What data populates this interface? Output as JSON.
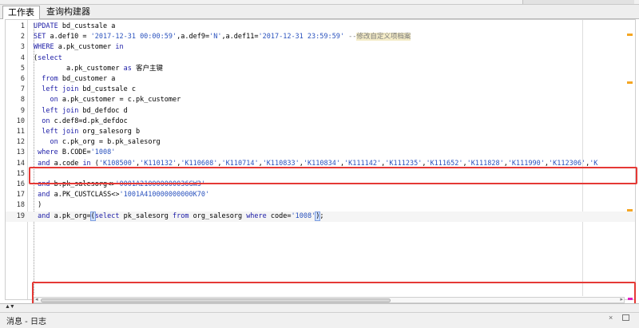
{
  "tabs": [
    {
      "label": "工作表"
    },
    {
      "label": "查询构建器"
    }
  ],
  "editor": {
    "lines": [
      {
        "n": "1",
        "parts": [
          {
            "t": "UPDATE",
            "c": "kw"
          },
          {
            "t": " bd_custsale a",
            "c": ""
          }
        ]
      },
      {
        "n": "2",
        "parts": [
          {
            "t": "SET",
            "c": "kw"
          },
          {
            "t": " a.def10 = ",
            "c": ""
          },
          {
            "t": "'2017-12-31 00:00:59'",
            "c": "str"
          },
          {
            "t": ",a.def9=",
            "c": ""
          },
          {
            "t": "'N'",
            "c": "str"
          },
          {
            "t": ",a.def11=",
            "c": ""
          },
          {
            "t": "'2017-12-31 23:59:59'",
            "c": "str"
          },
          {
            "t": " --",
            "c": "cmt"
          },
          {
            "t": "修改自定义项档案",
            "c": "cmt-hl cjk"
          }
        ]
      },
      {
        "n": "3",
        "parts": [
          {
            "t": "WHERE",
            "c": "kw"
          },
          {
            "t": " a.pk_customer ",
            "c": ""
          },
          {
            "t": "in",
            "c": "kw"
          }
        ]
      },
      {
        "n": "4",
        "parts": [
          {
            "t": "(",
            "c": ""
          },
          {
            "t": "select",
            "c": "kw"
          }
        ]
      },
      {
        "n": "5",
        "parts": [
          {
            "t": "        a.pk_customer ",
            "c": ""
          },
          {
            "t": "as",
            "c": "kw"
          },
          {
            "t": " ",
            "c": ""
          },
          {
            "t": "客户主键",
            "c": "cjk"
          }
        ]
      },
      {
        "n": "6",
        "parts": [
          {
            "t": "  ",
            "c": ""
          },
          {
            "t": "from",
            "c": "kw"
          },
          {
            "t": " bd_customer a",
            "c": ""
          }
        ]
      },
      {
        "n": "7",
        "parts": [
          {
            "t": "  ",
            "c": ""
          },
          {
            "t": "left join",
            "c": "kw"
          },
          {
            "t": " bd_custsale c",
            "c": ""
          }
        ]
      },
      {
        "n": "8",
        "parts": [
          {
            "t": "    ",
            "c": ""
          },
          {
            "t": "on",
            "c": "kw"
          },
          {
            "t": " a.pk_customer = c.pk_customer",
            "c": ""
          }
        ]
      },
      {
        "n": "9",
        "parts": [
          {
            "t": "  ",
            "c": ""
          },
          {
            "t": "left join",
            "c": "kw"
          },
          {
            "t": " bd_defdoc d",
            "c": ""
          }
        ]
      },
      {
        "n": "10",
        "parts": [
          {
            "t": "  ",
            "c": ""
          },
          {
            "t": "on",
            "c": "kw"
          },
          {
            "t": " c.def8=d.pk_defdoc",
            "c": ""
          }
        ]
      },
      {
        "n": "11",
        "parts": [
          {
            "t": "  ",
            "c": ""
          },
          {
            "t": "left join",
            "c": "kw"
          },
          {
            "t": " org_salesorg b",
            "c": ""
          }
        ]
      },
      {
        "n": "12",
        "parts": [
          {
            "t": "    ",
            "c": ""
          },
          {
            "t": "on",
            "c": "kw"
          },
          {
            "t": " c.pk_org = b.pk_salesorg",
            "c": ""
          }
        ]
      },
      {
        "n": "13",
        "parts": [
          {
            "t": " ",
            "c": ""
          },
          {
            "t": "where",
            "c": "kw"
          },
          {
            "t": " B.CODE=",
            "c": ""
          },
          {
            "t": "'1008'",
            "c": "str"
          }
        ]
      },
      {
        "n": "14",
        "parts": [
          {
            "t": " ",
            "c": ""
          },
          {
            "t": "and",
            "c": "kw"
          },
          {
            "t": " a.code ",
            "c": ""
          },
          {
            "t": "in",
            "c": "kw"
          },
          {
            "t": " (",
            "c": ""
          },
          {
            "t": "'K108500'",
            "c": "str"
          },
          {
            "t": ",",
            "c": ""
          },
          {
            "t": "'K110132'",
            "c": "str"
          },
          {
            "t": ",",
            "c": ""
          },
          {
            "t": "'K110608'",
            "c": "str"
          },
          {
            "t": ",",
            "c": ""
          },
          {
            "t": "'K110714'",
            "c": "str"
          },
          {
            "t": ",",
            "c": ""
          },
          {
            "t": "'K110833'",
            "c": "str"
          },
          {
            "t": ",",
            "c": ""
          },
          {
            "t": "'K110834'",
            "c": "str"
          },
          {
            "t": ",",
            "c": ""
          },
          {
            "t": "'K111142'",
            "c": "str"
          },
          {
            "t": ",",
            "c": ""
          },
          {
            "t": "'K111235'",
            "c": "str"
          },
          {
            "t": ",",
            "c": ""
          },
          {
            "t": "'K111652'",
            "c": "str"
          },
          {
            "t": ",",
            "c": ""
          },
          {
            "t": "'K111828'",
            "c": "str"
          },
          {
            "t": ",",
            "c": ""
          },
          {
            "t": "'K111990'",
            "c": "str"
          },
          {
            "t": ",",
            "c": ""
          },
          {
            "t": "'K112306'",
            "c": "str"
          },
          {
            "t": ",",
            "c": ""
          },
          {
            "t": "'K",
            "c": "str"
          }
        ]
      },
      {
        "n": "15",
        "parts": []
      },
      {
        "n": "16",
        "parts": [
          {
            "t": " ",
            "c": ""
          },
          {
            "t": "and",
            "c": "kw"
          },
          {
            "t": " b.pk_salesorg<>",
            "c": ""
          },
          {
            "t": "'0001A210000000036GW3'",
            "c": "str"
          }
        ]
      },
      {
        "n": "17",
        "parts": [
          {
            "t": " ",
            "c": ""
          },
          {
            "t": "and",
            "c": "kw"
          },
          {
            "t": " a.PK_CUSTCLASS<>",
            "c": ""
          },
          {
            "t": "'1001A410000000000K70'",
            "c": "str"
          }
        ]
      },
      {
        "n": "18",
        "parts": [
          {
            "t": " )",
            "c": ""
          }
        ]
      },
      {
        "n": "19",
        "parts": [
          {
            "t": " ",
            "c": ""
          },
          {
            "t": "and",
            "c": "kw"
          },
          {
            "t": " a.pk_org=",
            "c": ""
          },
          {
            "t": "(",
            "c": "paren-hl"
          },
          {
            "t": "select",
            "c": "kw"
          },
          {
            "t": " pk_salesorg ",
            "c": ""
          },
          {
            "t": "from",
            "c": "kw"
          },
          {
            "t": " org_salesorg ",
            "c": ""
          },
          {
            "t": "where",
            "c": "kw"
          },
          {
            "t": " code=",
            "c": ""
          },
          {
            "t": "'1008'",
            "c": "str"
          },
          {
            "t": ")",
            "c": "paren-hl"
          },
          {
            "t": ";",
            "c": ""
          }
        ]
      }
    ]
  },
  "message_panel": {
    "title": "消息 - 日志",
    "close_glyph": "×",
    "collapse_glyph": "▲▼"
  },
  "scroll": {
    "left_glyph": "◂",
    "right_glyph": "▸"
  },
  "colors": {
    "keyword": "#1a1aa6",
    "string": "#2a52be",
    "highlight_box": "#e53935",
    "marker": "#f5a623"
  }
}
